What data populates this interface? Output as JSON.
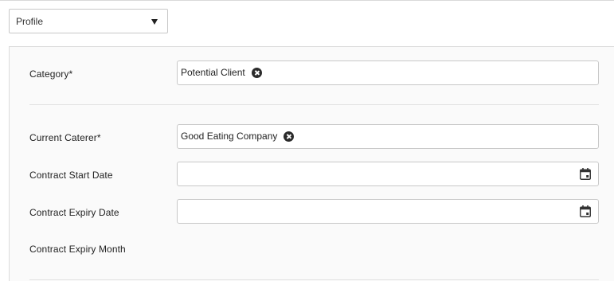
{
  "view_select": {
    "selected": "Profile"
  },
  "form": {
    "category": {
      "label": "Category*",
      "value": "Potential Client"
    },
    "current_caterer": {
      "label": "Current Caterer*",
      "value": "Good Eating Company"
    },
    "contract_start_date": {
      "label": "Contract Start Date",
      "value": ""
    },
    "contract_expiry_date": {
      "label": "Contract Expiry Date",
      "value": ""
    },
    "contract_expiry_month": {
      "label": "Contract Expiry Month",
      "value": ""
    }
  },
  "icons": {
    "dropdown": "chevron-down-icon",
    "clear": "clear-icon",
    "calendar": "calendar-icon"
  }
}
